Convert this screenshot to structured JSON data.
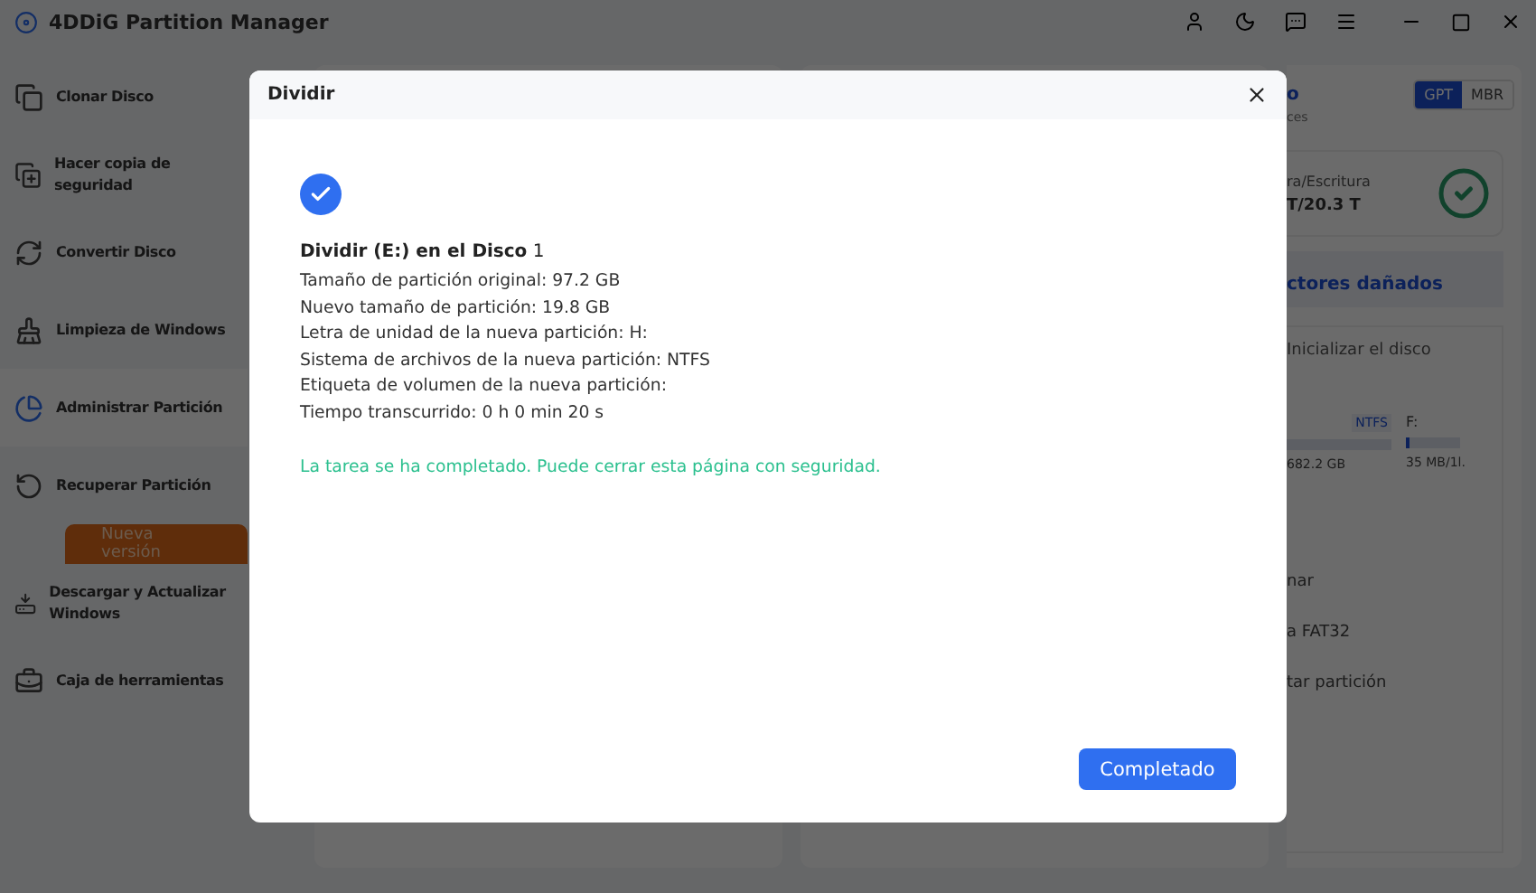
{
  "app": {
    "title": "4DDiG Partition Manager"
  },
  "sidebar": {
    "items": [
      {
        "label": "Clonar Disco",
        "kind": "clone",
        "selected": false
      },
      {
        "label": "Hacer copia de seguridad",
        "kind": "backup",
        "selected": false
      },
      {
        "label": "Convertir Disco",
        "kind": "convert",
        "selected": false
      },
      {
        "label": "Limpieza de Windows",
        "kind": "clean",
        "selected": false
      },
      {
        "label": "Administrar Partición",
        "kind": "partition",
        "selected": true
      },
      {
        "label": "Recuperar Partición",
        "kind": "recover",
        "selected": false
      },
      {
        "label": "Descargar y Actualizar Windows",
        "kind": "download",
        "selected": false,
        "badge": "Nueva versión"
      },
      {
        "label": "Caja de herramientas",
        "kind": "toolbox",
        "selected": false
      }
    ]
  },
  "disk_panel": {
    "title_fragment": "o",
    "subtitle_fragment": "ces",
    "partition_styles": [
      {
        "label": "GPT",
        "selected": true
      },
      {
        "label": "MBR",
        "selected": false
      }
    ],
    "speed_label": "ra/Escritura",
    "speed_value": "T/20.3 T",
    "bad_sectors_link": "ctores dañados",
    "init_button": "Inicializar el disco",
    "partitions": [
      {
        "fs": "NTFS",
        "size": "682.2 GB"
      },
      {
        "letter": "F:",
        "size": "35 MB/1l.",
        "level": 0.06
      }
    ],
    "actions": [
      "nar",
      "a FAT32",
      "tar partición"
    ]
  },
  "dialog": {
    "title": "Dividir",
    "heading": "**Dividir (E:) en el Disco** 1",
    "details": [
      "Tamaño de partición original: 97.2 GB",
      "Nuevo tamaño de partición: 19.8 GB",
      "Letra de unidad de la nueva partición: H:",
      "Sistema de archivos de la nueva partición: NTFS",
      "Etiqueta de volumen de la nueva partición:",
      "Tiempo transcurrido: 0 h 0 min 20 s"
    ],
    "message": "La tarea se ha completado. Puede cerrar esta página con seguridad.",
    "button": "Completado"
  }
}
